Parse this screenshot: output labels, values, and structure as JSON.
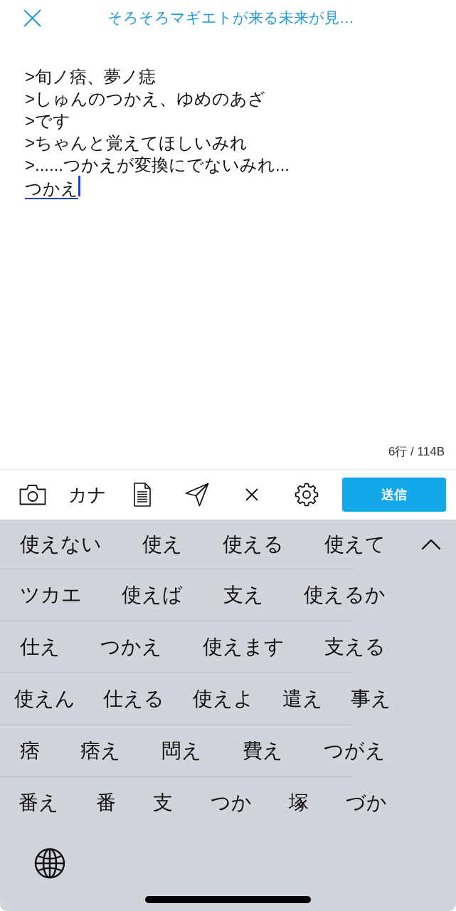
{
  "header": {
    "title": "そろそろマギエトが来る未来が見…"
  },
  "compose": {
    "lines": [
      ">旬ノ痞、夢ノ痣",
      ">しゅんのつかえ、ゆめのあざ",
      ">です",
      ">ちゃんと覚えてほしいみれ",
      ">......つかえが変換にでないみれ..."
    ],
    "composing_text": "つかえ",
    "counter": "6行 / 114B"
  },
  "toolbar": {
    "kana_label": "カナ",
    "send_button": "送信"
  },
  "keyboard": {
    "candidate_rows": [
      [
        "使えない",
        "使え",
        "使える",
        "使えて"
      ],
      [
        "ツカエ",
        "使えば",
        "支え",
        "使えるか"
      ],
      [
        "仕え",
        "つかえ",
        "使えます",
        "支える"
      ],
      [
        "使えん",
        "仕える",
        "使えよ",
        "遣え",
        "事え"
      ],
      [
        "痞",
        "痞え",
        "閊え",
        "費え",
        "つがえ"
      ],
      [
        "番え",
        "番",
        "支",
        "つか",
        "塚",
        "づか"
      ]
    ]
  }
}
